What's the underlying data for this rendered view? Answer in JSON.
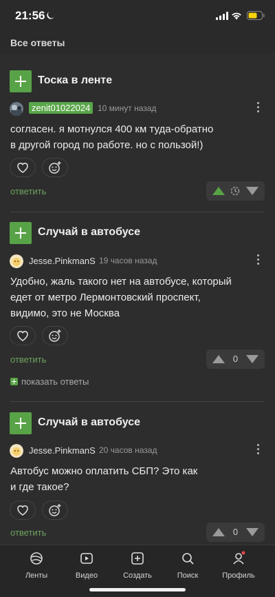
{
  "status": {
    "time": "21:56"
  },
  "header": {
    "title": "Все ответы"
  },
  "posts": [
    {
      "title": "Тоска в ленте",
      "author": "zenit01022024",
      "time": "10 минут назад",
      "text_lines": [
        "согласен. я мотнулся 400 км туда-обратно",
        "в другой город по работе. но с пользой!)"
      ],
      "reply": "ответить"
    },
    {
      "title": "Случай в автобусе",
      "author": "Jesse.PinkmanS",
      "time": "19 часов назад",
      "text_lines": [
        "Удобно, жаль такого нет на автобусе, который",
        "едет от метро Лермонтовский проспект,",
        "видимо, это не Москва"
      ],
      "reply": "ответить",
      "score": "0",
      "show_replies": "показать ответы"
    },
    {
      "title": "Случай в автобусе",
      "author": "Jesse.PinkmanS",
      "time": "20 часов назад",
      "text_lines": [
        "Автобус можно оплатить СБП? Это как",
        "и где такое?"
      ],
      "reply": "ответить",
      "score": "0"
    }
  ],
  "tabs": [
    {
      "label": "Ленты",
      "icon": "feeds-icon"
    },
    {
      "label": "Видео",
      "icon": "video-icon"
    },
    {
      "label": "Создать",
      "icon": "create-icon"
    },
    {
      "label": "Поиск",
      "icon": "search-icon"
    },
    {
      "label": "Профиль",
      "icon": "profile-icon"
    }
  ],
  "colors": {
    "accent": "#58a347",
    "background": "#2d2d2d",
    "notification": "#e5484d"
  }
}
